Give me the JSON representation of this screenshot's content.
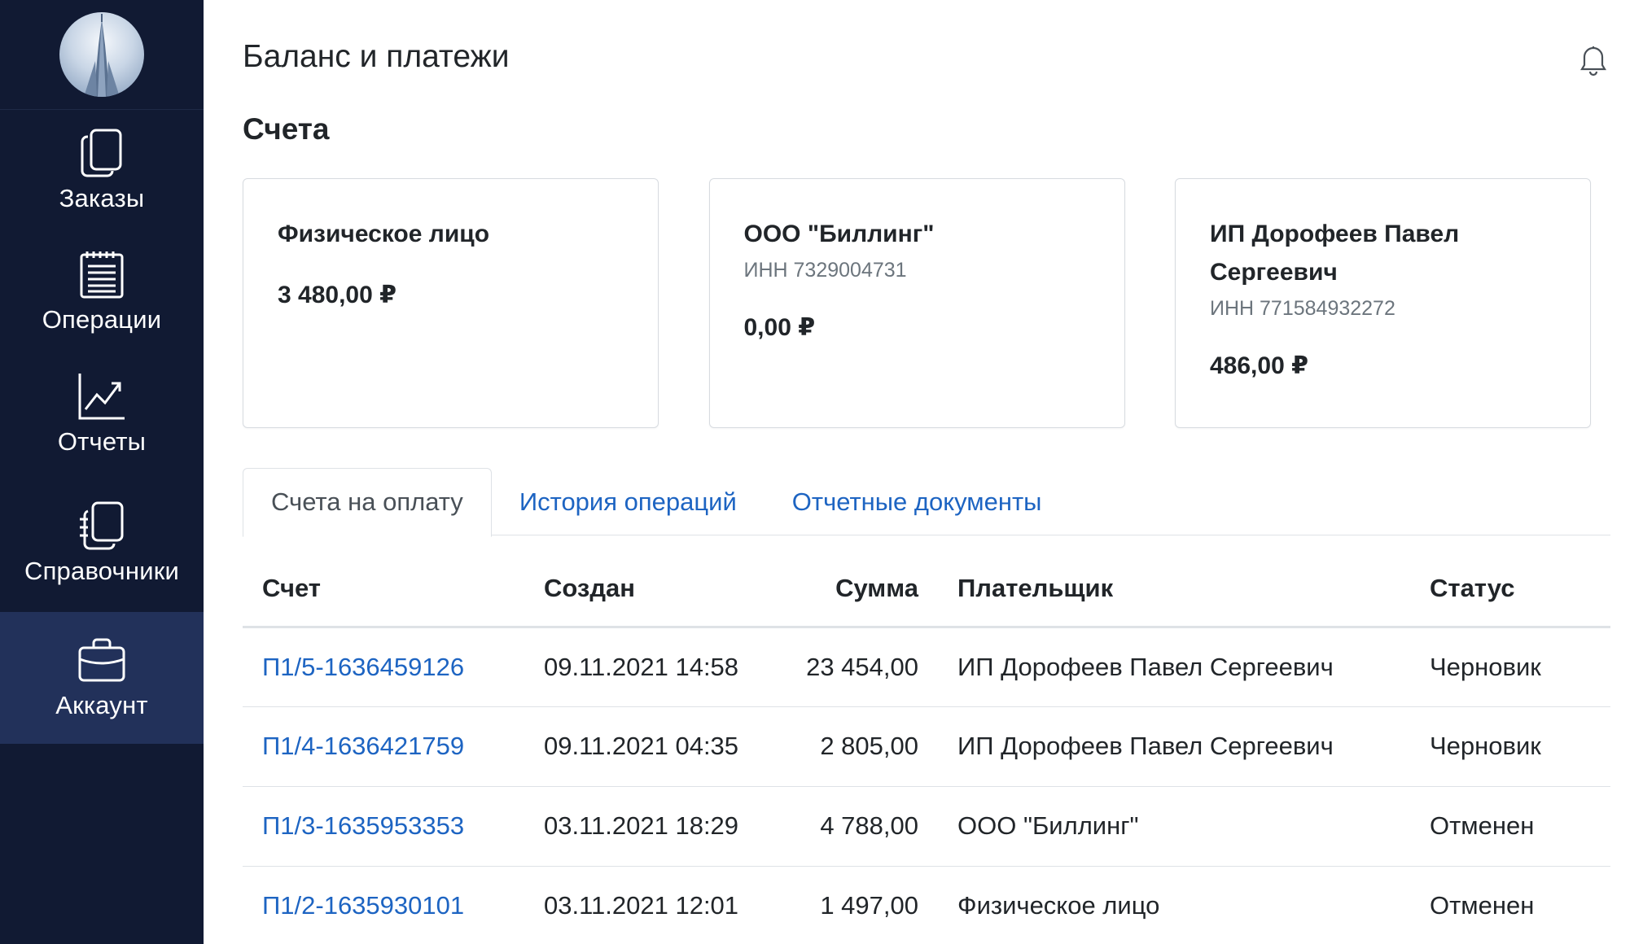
{
  "sidebar": {
    "items": [
      {
        "id": "orders",
        "label": "Заказы",
        "icon": "copy-icon"
      },
      {
        "id": "operations",
        "label": "Операции",
        "icon": "notepad-icon"
      },
      {
        "id": "reports",
        "label": "Отчеты",
        "icon": "chart-icon"
      },
      {
        "id": "directories",
        "label": "Справочники",
        "icon": "notebook-icon"
      },
      {
        "id": "account",
        "label": "Аккаунт",
        "icon": "briefcase-icon",
        "active": true
      }
    ]
  },
  "header": {
    "title": "Баланс и платежи",
    "bell_icon": "bell-icon"
  },
  "accounts_section": {
    "title": "Счета",
    "cards": [
      {
        "name": "Физическое лицо",
        "inn": "",
        "amount": "3 480,00 ₽"
      },
      {
        "name": "ООО \"Биллинг\"",
        "inn": "ИНН 7329004731",
        "amount": "0,00 ₽"
      },
      {
        "name": "ИП Дорофеев Павел Сергеевич",
        "inn": "ИНН 771584932272",
        "amount": "486,00 ₽"
      }
    ]
  },
  "tabs": [
    {
      "label": "Счета на оплату",
      "active": true
    },
    {
      "label": "История операций",
      "active": false
    },
    {
      "label": "Отчетные документы",
      "active": false
    }
  ],
  "table": {
    "headers": {
      "invoice": "Счет",
      "created": "Создан",
      "sum": "Сумма",
      "payer": "Плательщик",
      "status": "Статус"
    },
    "rows": [
      {
        "invoice": "П1/5-1636459126",
        "created": "09.11.2021 14:58",
        "sum": "23 454,00",
        "payer": "ИП Дорофеев Павел Сергеевич",
        "status": "Черновик"
      },
      {
        "invoice": "П1/4-1636421759",
        "created": "09.11.2021 04:35",
        "sum": "2 805,00",
        "payer": "ИП Дорофеев Павел Сергеевич",
        "status": "Черновик"
      },
      {
        "invoice": "П1/3-1635953353",
        "created": "03.11.2021 18:29",
        "sum": "4 788,00",
        "payer": "ООО \"Биллинг\"",
        "status": "Отменен"
      },
      {
        "invoice": "П1/2-1635930101",
        "created": "03.11.2021 12:01",
        "sum": "1 497,00",
        "payer": "Физическое лицо",
        "status": "Отменен"
      }
    ]
  },
  "colors": {
    "sidebar_bg": "#111a33",
    "sidebar_active": "#22315a",
    "link": "#1d64c2"
  }
}
